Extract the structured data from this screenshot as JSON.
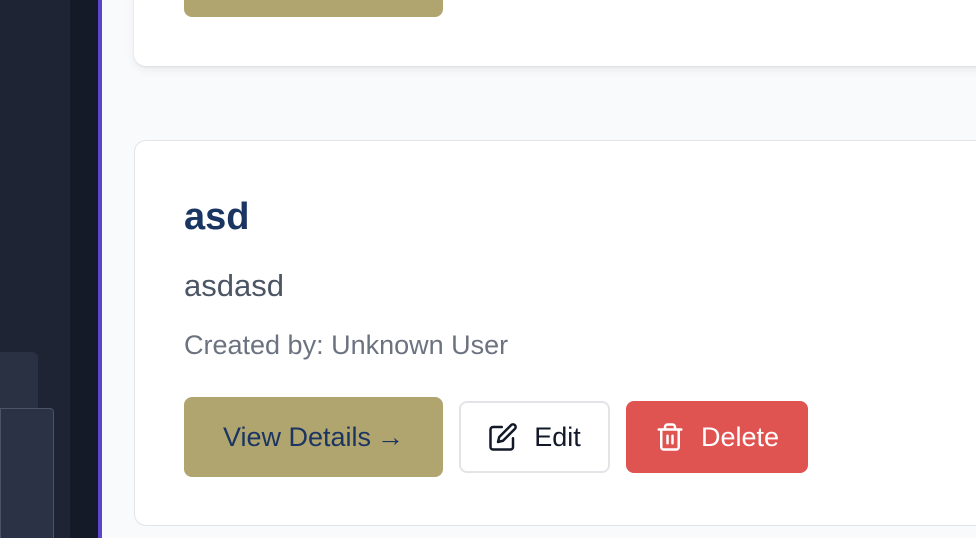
{
  "card": {
    "title": "asd",
    "description": "asdasd",
    "created_by": "Created by: Unknown User"
  },
  "actions": {
    "view_label": "View Details",
    "view_arrow": "→",
    "edit_label": "Edit",
    "delete_label": "Delete"
  },
  "icons": {
    "edit": "edit-icon",
    "delete": "trash-icon"
  },
  "colors": {
    "accent_gold": "#b1a56f",
    "title_navy": "#1b3563",
    "danger_red": "#df5350",
    "sidebar_purple": "#5b46c9"
  }
}
